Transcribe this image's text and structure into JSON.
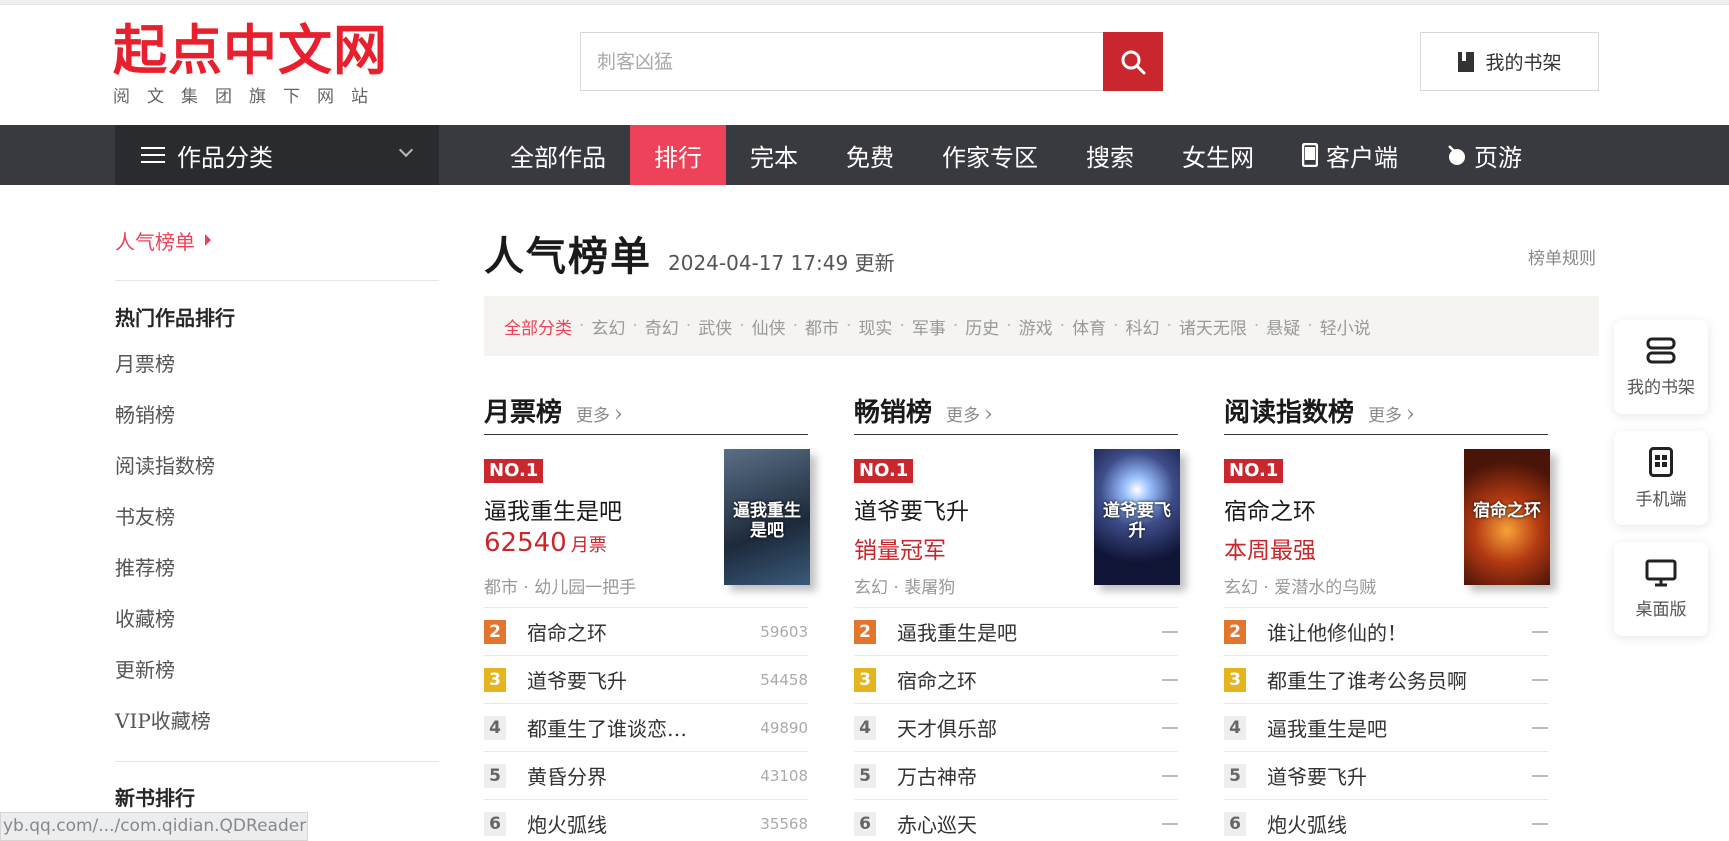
{
  "header": {
    "logo_main": "起点中文网",
    "logo_sub": "阅文集团旗下网站",
    "search_placeholder": "刺客凶猛",
    "shelf_label": "我的书架"
  },
  "nav": {
    "category_label": "作品分类",
    "items": [
      {
        "label": "全部作品"
      },
      {
        "label": "排行",
        "active": true
      },
      {
        "label": "完本"
      },
      {
        "label": "免费"
      },
      {
        "label": "作家专区"
      },
      {
        "label": "搜索"
      },
      {
        "label": "女生网"
      },
      {
        "label": "客户端"
      },
      {
        "label": "页游"
      }
    ]
  },
  "sidebar": {
    "current": "人气榜单",
    "section1_title": "热门作品排行",
    "links": [
      "月票榜",
      "畅销榜",
      "阅读指数榜",
      "书友榜",
      "推荐榜",
      "收藏榜",
      "更新榜",
      "VIP收藏榜"
    ],
    "section2_title": "新书排行"
  },
  "main": {
    "title": "人气榜单",
    "updated_time": "2024-04-17 17:49",
    "updated_suffix": "更新",
    "rules_link": "榜单规则",
    "filters": [
      "全部分类",
      "玄幻",
      "奇幻",
      "武侠",
      "仙侠",
      "都市",
      "现实",
      "军事",
      "历史",
      "游戏",
      "体育",
      "科幻",
      "诸天无限",
      "悬疑",
      "轻小说"
    ]
  },
  "columns": [
    {
      "title": "月票榜",
      "more": "更多",
      "top": {
        "badge": "NO.1",
        "name": "逼我重生是吧",
        "stat": "62540",
        "stat_unit": "月票",
        "meta": "都市 · 幼儿园一把手",
        "cover_text": "逼我重生是吧"
      },
      "rows": [
        {
          "rank": "2",
          "name": "宿命之环",
          "value": "59603"
        },
        {
          "rank": "3",
          "name": "道爷要飞升",
          "value": "54458"
        },
        {
          "rank": "4",
          "name": "都重生了谁谈恋…",
          "value": "49890"
        },
        {
          "rank": "5",
          "name": "黄昏分界",
          "value": "43108"
        },
        {
          "rank": "6",
          "name": "炮火弧线",
          "value": "35568"
        }
      ]
    },
    {
      "title": "畅销榜",
      "more": "更多",
      "top": {
        "badge": "NO.1",
        "name": "道爷要飞升",
        "stat": "销量冠军",
        "stat_unit": "",
        "meta": "玄幻 · 裴屠狗",
        "cover_text": "道爷要飞升"
      },
      "rows": [
        {
          "rank": "2",
          "name": "逼我重生是吧",
          "value": ""
        },
        {
          "rank": "3",
          "name": "宿命之环",
          "value": ""
        },
        {
          "rank": "4",
          "name": "天才俱乐部",
          "value": ""
        },
        {
          "rank": "5",
          "name": "万古神帝",
          "value": ""
        },
        {
          "rank": "6",
          "name": "赤心巡天",
          "value": ""
        }
      ]
    },
    {
      "title": "阅读指数榜",
      "more": "更多",
      "top": {
        "badge": "NO.1",
        "name": "宿命之环",
        "stat": "本周最强",
        "stat_unit": "",
        "meta": "玄幻 · 爱潜水的乌贼",
        "cover_text": "宿命之环"
      },
      "rows": [
        {
          "rank": "2",
          "name": "谁让他修仙的！",
          "value": ""
        },
        {
          "rank": "3",
          "name": "都重生了谁考公务员啊",
          "value": ""
        },
        {
          "rank": "4",
          "name": "逼我重生是吧",
          "value": ""
        },
        {
          "rank": "5",
          "name": "道爷要飞升",
          "value": ""
        },
        {
          "rank": "6",
          "name": "炮火弧线",
          "value": ""
        }
      ]
    }
  ],
  "float": {
    "shelf": "我的书架",
    "mobile": "手机端",
    "desktop": "桌面版"
  },
  "status_url": "yb.qq.com/.../com.qidian.QDReader",
  "colors": {
    "brand_red": "#e8202e",
    "nav_bg": "#393a3f",
    "active_tab": "#ed4259",
    "search_btn": "#c9272d"
  }
}
